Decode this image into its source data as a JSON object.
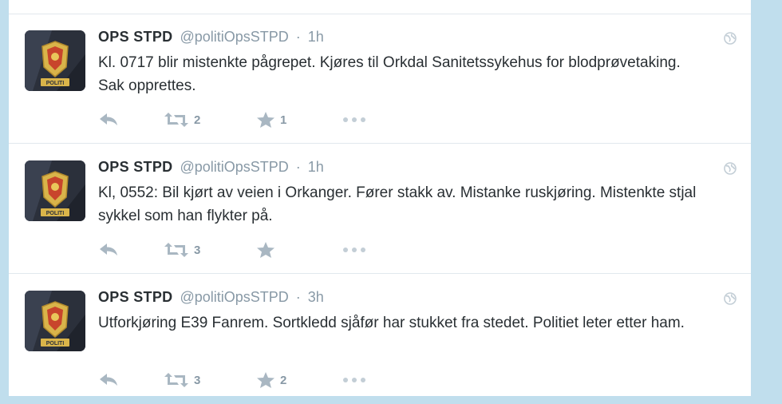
{
  "tweets": [
    {
      "fullname": "OPS STPD",
      "username": "@politiOpsSTPD",
      "separator": "·",
      "time": "1h",
      "text": "Kl. 0717 blir mistenkte pågrepet. Kjøres til Orkdal Sanitetssykehus for blodprøvetaking. Sak opprettes.",
      "retweets": "2",
      "favorites": "1",
      "avatar_badge": "POLITI"
    },
    {
      "fullname": "OPS STPD",
      "username": "@politiOpsSTPD",
      "separator": "·",
      "time": "1h",
      "text": "Kl, 0552: Bil kjørt av veien i Orkanger. Fører stakk av. Mistanke ruskjøring. Mistenkte stjal sykkel som han flykter på.",
      "retweets": "3",
      "favorites": "",
      "avatar_badge": "POLITI"
    },
    {
      "fullname": "OPS STPD",
      "username": "@politiOpsSTPD",
      "separator": "·",
      "time": "3h",
      "text": "Utforkjøring E39 Fanrem. Sortkledd sjåfør har stukket fra stedet. Politiet leter etter ham.",
      "retweets": "3",
      "favorites": "2",
      "avatar_badge": "POLITI"
    }
  ],
  "icons": {
    "reply": "reply-icon",
    "retweet": "retweet-icon",
    "favorite": "star-icon",
    "more": "more-dots-icon",
    "globe": "globe-icon"
  },
  "colors": {
    "page_background": "#c0deed",
    "icon_gray": "#a9b7c2",
    "meta_gray": "#8899a6",
    "text": "#292f33"
  }
}
